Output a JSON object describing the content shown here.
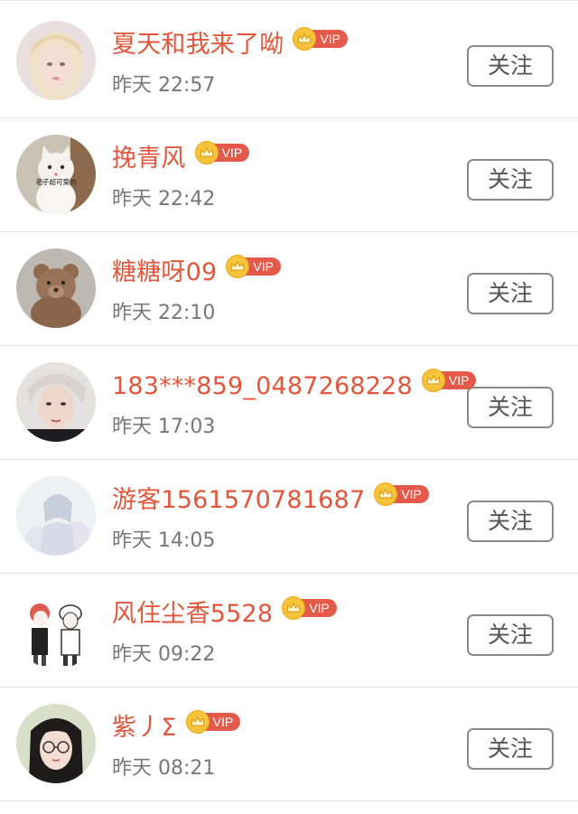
{
  "followers": [
    {
      "name": "夏天和我来了呦",
      "time": "昨天 22:57",
      "vip_label": "VIP",
      "button": "关注",
      "avatar": "blonde-girl-avatar"
    },
    {
      "name": "挽青风",
      "time": "昨天 22:42",
      "vip_label": "VIP",
      "button": "关注",
      "avatar": "cat-avatar",
      "avatar_text": "老子超可爱的"
    },
    {
      "name": "糖糖呀09",
      "time": "昨天 22:10",
      "vip_label": "VIP",
      "button": "关注",
      "avatar": "teddy-bear-avatar"
    },
    {
      "name": "183***859_0487268228",
      "time": "昨天 17:03",
      "vip_label": "VIP",
      "button": "关注",
      "avatar": "young-man-avatar"
    },
    {
      "name": "游客1561570781687",
      "time": "昨天 14:05",
      "vip_label": "VIP",
      "button": "关注",
      "avatar": "pastel-drawing-avatar"
    },
    {
      "name": "风住尘香5528",
      "time": "昨天 09:22",
      "vip_label": "VIP",
      "button": "关注",
      "avatar": "couple-cartoon-avatar"
    },
    {
      "name": "紫丿Σ",
      "time": "昨天 08:21",
      "vip_label": "VIP",
      "button": "关注",
      "avatar": "glasses-girl-avatar"
    }
  ],
  "colors": {
    "name": "#e2573b",
    "vip_badge": "#e45a4a",
    "crown": "#f6c33a",
    "time": "#777777",
    "button_border": "#8a8a8a"
  }
}
